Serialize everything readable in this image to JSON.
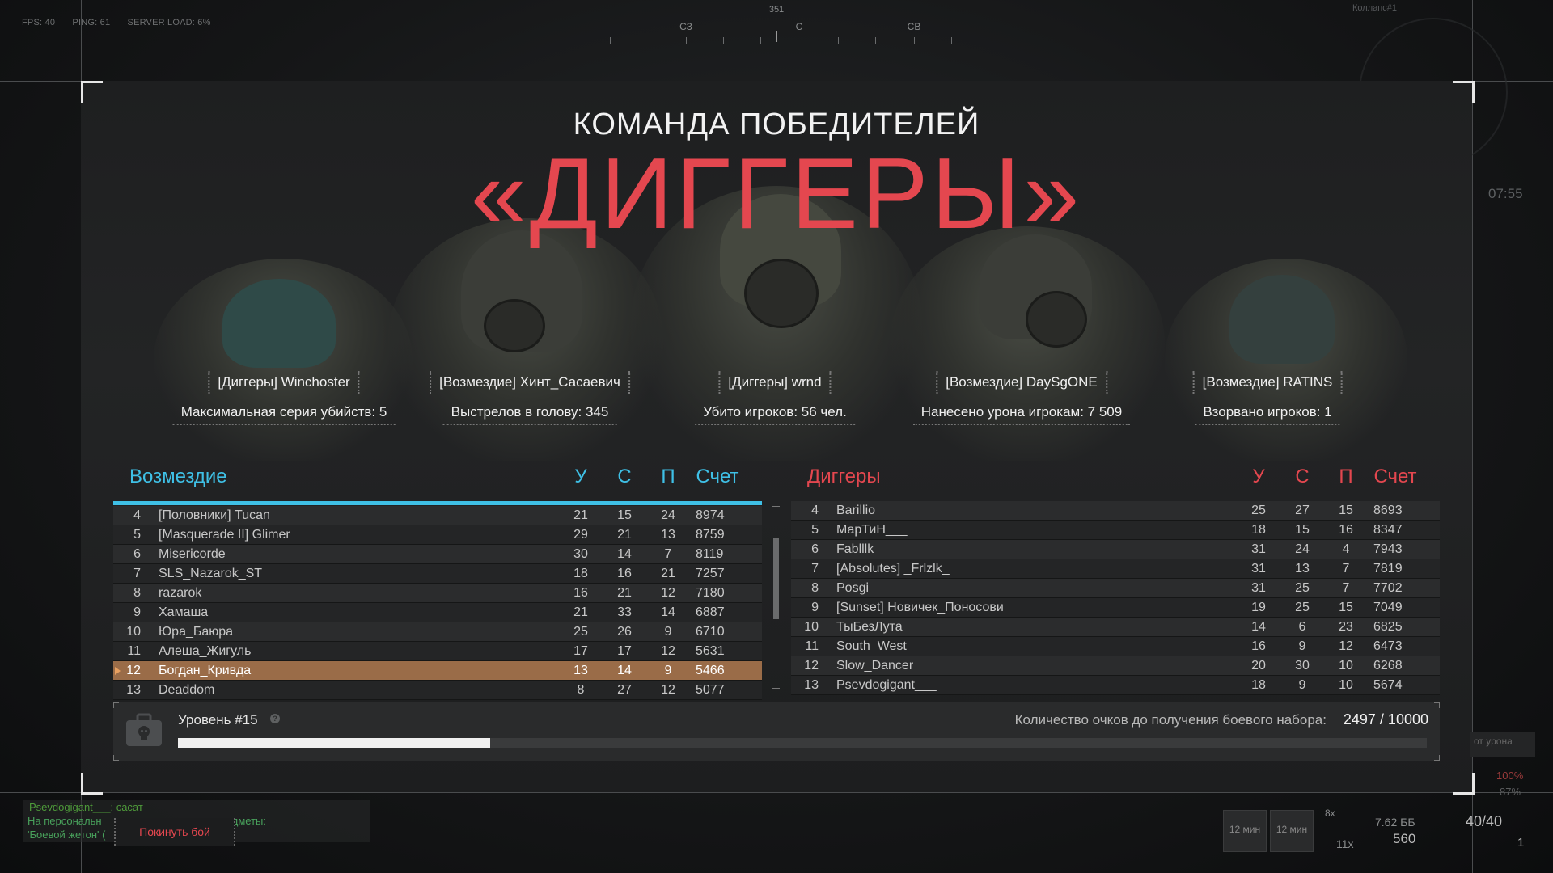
{
  "hud": {
    "fps": "FPS: 40",
    "ping": "PING: 61",
    "server_load": "SERVER LOAD: 6%",
    "compass_degree": "351",
    "compass_labels": [
      "СЗ",
      "С",
      "СВ"
    ],
    "map_name": "Коллапс#1",
    "timer": "07:55"
  },
  "title": {
    "subtitle": "КОМАНДА ПОБЕДИТЕЛЕЙ",
    "team": "«ДИГГЕРЫ»"
  },
  "mvp": [
    {
      "name": "[Диггеры] Winchoster",
      "stat": "Максимальная серия убийств: 5"
    },
    {
      "name": "[Возмездие] Хинт_Сасаевич",
      "stat": "Выстрелов в голову: 345"
    },
    {
      "name": "[Диггеры] wrnd",
      "stat": "Убито игроков: 56 чел."
    },
    {
      "name": "[Возмездие] DaySgONE",
      "stat": "Нанесено урона игрокам: 7 509"
    },
    {
      "name": "[Возмездие] RATINS",
      "stat": "Взорвано игроков: 1"
    }
  ],
  "columns": {
    "kills": "У",
    "assists": "С",
    "deaths": "П",
    "score": "Счет"
  },
  "teams": {
    "left": {
      "name": "Возмездие",
      "color": "#3fc0e6",
      "rows": [
        {
          "rank": "4",
          "name": "[Половники] Tucan_",
          "k": "21",
          "a": "15",
          "d": "24",
          "s": "8974"
        },
        {
          "rank": "5",
          "name": "[Masquerade II] Glimer",
          "k": "29",
          "a": "21",
          "d": "13",
          "s": "8759"
        },
        {
          "rank": "6",
          "name": "Misericorde",
          "k": "30",
          "a": "14",
          "d": "7",
          "s": "8119"
        },
        {
          "rank": "7",
          "name": "SLS_Nazarok_ST",
          "k": "18",
          "a": "16",
          "d": "21",
          "s": "7257"
        },
        {
          "rank": "8",
          "name": "razarok",
          "k": "16",
          "a": "21",
          "d": "12",
          "s": "7180"
        },
        {
          "rank": "9",
          "name": "Хамаша",
          "k": "21",
          "a": "33",
          "d": "14",
          "s": "6887"
        },
        {
          "rank": "10",
          "name": "Юра_Баюра",
          "k": "25",
          "a": "26",
          "d": "9",
          "s": "6710"
        },
        {
          "rank": "11",
          "name": "Алеша_Жигуль",
          "k": "17",
          "a": "17",
          "d": "12",
          "s": "5631"
        },
        {
          "rank": "12",
          "name": "Богдан_Кривда",
          "k": "13",
          "a": "14",
          "d": "9",
          "s": "5466"
        },
        {
          "rank": "13",
          "name": "Deaddom",
          "k": "8",
          "a": "27",
          "d": "12",
          "s": "5077"
        }
      ]
    },
    "right": {
      "name": "Диггеры",
      "color": "#e4474f",
      "rows": [
        {
          "rank": "4",
          "name": "Barillio",
          "k": "25",
          "a": "27",
          "d": "15",
          "s": "8693"
        },
        {
          "rank": "5",
          "name": "МарТиН___",
          "k": "18",
          "a": "15",
          "d": "16",
          "s": "8347"
        },
        {
          "rank": "6",
          "name": "Fablllk",
          "k": "31",
          "a": "24",
          "d": "4",
          "s": "7943"
        },
        {
          "rank": "7",
          "name": "[Absolutes] _Frlzlk_",
          "k": "31",
          "a": "13",
          "d": "7",
          "s": "7819"
        },
        {
          "rank": "8",
          "name": "Posgi",
          "k": "31",
          "a": "25",
          "d": "7",
          "s": "7702"
        },
        {
          "rank": "9",
          "name": "[Sunset] Новичек_Поносови",
          "k": "19",
          "a": "25",
          "d": "15",
          "s": "7049"
        },
        {
          "rank": "10",
          "name": "ТыБезЛута",
          "k": "14",
          "a": "6",
          "d": "23",
          "s": "6825"
        },
        {
          "rank": "11",
          "name": "South_West",
          "k": "16",
          "a": "9",
          "d": "12",
          "s": "6473"
        },
        {
          "rank": "12",
          "name": "Slow_Dancer",
          "k": "20",
          "a": "30",
          "d": "10",
          "s": "6268"
        },
        {
          "rank": "13",
          "name": "Psevdogigant___",
          "k": "18",
          "a": "9",
          "d": "10",
          "s": "5674"
        }
      ]
    }
  },
  "progress": {
    "level": "Уровень #15",
    "info_icon": "?",
    "points_label": "Количество очков до получения боевого набора:",
    "points_value": "2497 / 10000",
    "fraction": 0.2497
  },
  "chat": {
    "line1": "Psevdogigant___: сасат",
    "line2": "На персональн",
    "line2_end": "предметы:",
    "line3": "'Боевой жетон' ("
  },
  "leave_button": "Покинуть бой",
  "hud_bottom": {
    "damage_label": "от урона",
    "pct1": "100%",
    "pct2": "87%",
    "slot1": "12 мин",
    "slot2": "12 мин",
    "multiplier": "8x",
    "grenades": "11x",
    "ammo_caliber": "7.62 ББ",
    "ammo_reserve": "560",
    "ammo_mag": "40/40",
    "extra": "1"
  }
}
